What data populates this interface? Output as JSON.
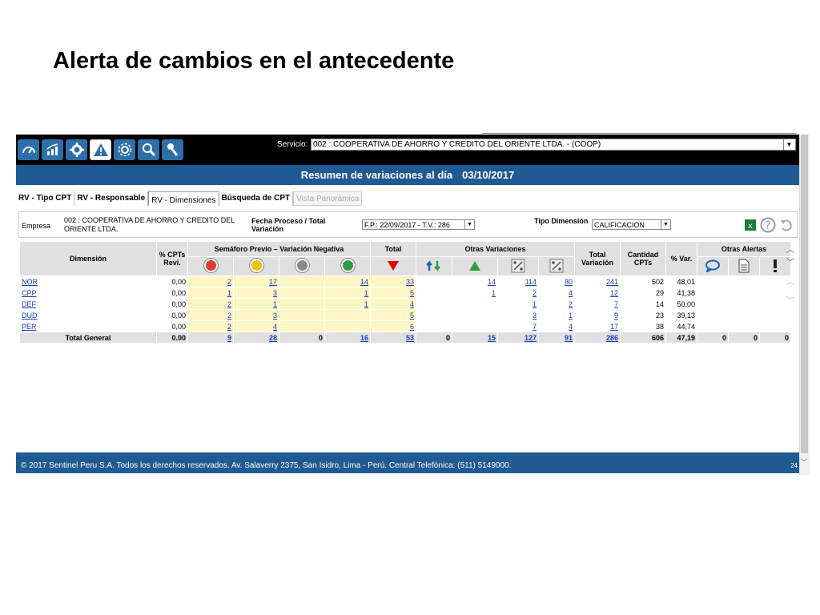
{
  "slide_title": "Alerta de cambios en el antecedente",
  "topbar": {
    "service_label": "Servicio:",
    "service_value": "002 : COOPERATIVA DE AHORRO Y CREDITO DEL ORIENTE LTDA. - (COOP)"
  },
  "banner": {
    "title": "Resumen de variaciones al día",
    "date": "03/10/2017"
  },
  "tabs": [
    {
      "label": "RV - Tipo CPT"
    },
    {
      "label": "RV - Responsable"
    },
    {
      "label": "RV - Dimensiones"
    },
    {
      "label": "Búsqueda de CPT"
    },
    {
      "label": "Vista Panorámica"
    }
  ],
  "filters": {
    "empresa_label": "Empresa",
    "empresa_value": "002 : COOPERATIVA DE AHORRO Y CREDITO DEL ORIENTE LTDA.",
    "fecha_label": "Fecha Proceso / Total Variación",
    "fecha_value": "F.P.: 22/09/2017 - T.V.: 286",
    "tipo_label": "Tipo Dimensión",
    "tipo_value": "CALIFICACION"
  },
  "table": {
    "headers": {
      "dimension": "Dimensión",
      "cpts_revi": "% CPTs Revi.",
      "semaforo": "Semáforo Previo – Variación Negativa",
      "total": "Total",
      "otras_variaciones": "Otras Variaciones",
      "total_variacion": "Total Variación",
      "cantidad_cpts": "Cantidad CPTs",
      "pct_var": "% Var.",
      "otras_alertas": "Otras Alertas"
    },
    "rows": [
      {
        "dim": "NOR",
        "revi": "0,00",
        "red": "2",
        "yellow": "17",
        "gray": "",
        "green": "14",
        "total": "33",
        "v1": "",
        "v2": "14",
        "v3": "114",
        "v4": "80",
        "tv": "241",
        "cant": "502",
        "pct": "48,01"
      },
      {
        "dim": "CPP",
        "revi": "0,00",
        "red": "1",
        "yellow": "3",
        "gray": "",
        "green": "1",
        "total": "5",
        "v1": "",
        "v2": "1",
        "v3": "2",
        "v4": "4",
        "tv": "12",
        "cant": "29",
        "pct": "41,38"
      },
      {
        "dim": "DEF",
        "revi": "0,00",
        "red": "2",
        "yellow": "1",
        "gray": "",
        "green": "1",
        "total": "4",
        "v1": "",
        "v2": "",
        "v3": "1",
        "v4": "2",
        "tv": "7",
        "cant": "14",
        "pct": "50,00"
      },
      {
        "dim": "DUD",
        "revi": "0,00",
        "red": "2",
        "yellow": "3",
        "gray": "",
        "green": "",
        "total": "5",
        "v1": "",
        "v2": "",
        "v3": "3",
        "v4": "1",
        "tv": "9",
        "cant": "23",
        "pct": "39,13"
      },
      {
        "dim": "PER",
        "revi": "0,00",
        "red": "2",
        "yellow": "4",
        "gray": "",
        "green": "",
        "total": "6",
        "v1": "",
        "v2": "",
        "v3": "7",
        "v4": "4",
        "tv": "17",
        "cant": "38",
        "pct": "44,74"
      }
    ],
    "total_row": {
      "label": "Total General",
      "revi": "0.00",
      "red": "9",
      "yellow": "28",
      "gray": "0",
      "green": "16",
      "total": "53",
      "v1": "0",
      "v2": "15",
      "v3": "127",
      "v4": "91",
      "tv": "286",
      "cant": "606",
      "pct": "47,19",
      "a1": "0",
      "a2": "0",
      "a3": "0"
    }
  },
  "footer": {
    "text": "© 2017 Sentinel Peru S.A. Todos los derechos reservados. Av. Salaverry 2375, San Isidro, Lima - Perú. Central Telefónica: (511) 5149000.",
    "page": "24"
  },
  "colors": {
    "brand_blue": "#1f5a92",
    "highlight_yellow": "#fdf7c6",
    "link": "#1a3fb0"
  }
}
